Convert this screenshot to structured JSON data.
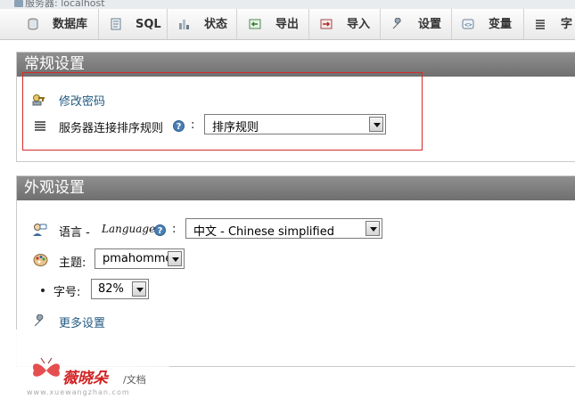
{
  "breadcrumb": {
    "text": "服务器: localhost"
  },
  "tabs": [
    {
      "label": "数据库",
      "icon": "database-icon"
    },
    {
      "label": "SQL",
      "icon": "sql-icon"
    },
    {
      "label": "状态",
      "icon": "status-icon"
    },
    {
      "label": "导出",
      "icon": "export-icon"
    },
    {
      "label": "导入",
      "icon": "import-icon"
    },
    {
      "label": "设置",
      "icon": "wrench-icon"
    },
    {
      "label": "变量",
      "icon": "variables-icon"
    },
    {
      "label": "字",
      "icon": "charset-icon"
    }
  ],
  "general": {
    "title": "常规设置",
    "change_password": "修改密码",
    "collation_label": "服务器连接排序规则",
    "colon": ":",
    "collation_value": "排序规则"
  },
  "appearance": {
    "title": "外观设置",
    "language_label": "语言 - ",
    "language_label_en": "Language",
    "colon": ":",
    "language_value": "中文 - Chinese simplified",
    "theme_label": "主题:",
    "theme_value": "pmahomme",
    "font_label": "字号:",
    "font_value": "82%",
    "more_settings": "更多设置"
  },
  "watermark": {
    "logo": "薇晓朵",
    "sub": "/文档",
    "url": "www.xuewangzhan.com"
  },
  "colors": {
    "accent_link": "#235a81",
    "panel_header": "#7f7f7f",
    "highlight_box": "#d42b2b"
  }
}
